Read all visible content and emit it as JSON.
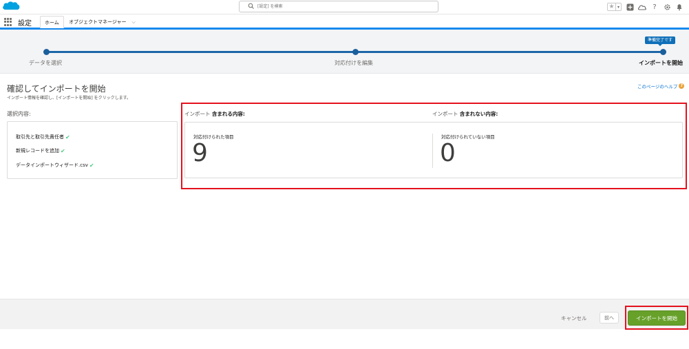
{
  "header": {
    "search_placeholder": "[設定] を検索",
    "icons": [
      "star-icon",
      "chevron-down-icon",
      "plus-icon",
      "cloud-icon",
      "help-icon",
      "gear-icon",
      "bell-icon"
    ]
  },
  "nav": {
    "app_name": "設定",
    "tabs": [
      {
        "label": "ホーム",
        "active": true
      },
      {
        "label": "オブジェクトマネージャー",
        "active": false
      }
    ]
  },
  "progress": {
    "steps": [
      {
        "label": "データを選択"
      },
      {
        "label": "対応付けを編集"
      },
      {
        "label": "インポートを開始"
      }
    ],
    "current_step": 3,
    "status_badge": "準備完了です"
  },
  "main": {
    "title": "確認してインポートを開始",
    "subtitle": "インポート情報を確認し、[インポートを開始] をクリックします。",
    "help_link": "このページのヘルプ"
  },
  "selection": {
    "label": "選択内容:",
    "items": [
      {
        "text": "取引先と取引先責任者"
      },
      {
        "text": "新規レコードを追加"
      },
      {
        "text": "データインポートウィザード.csv"
      }
    ]
  },
  "summary": {
    "included_prefix": "インポート",
    "included_bold": "含まれる内容:",
    "excluded_prefix": "インポート",
    "excluded_bold": "含まれない内容:",
    "mapped_label": "対応付けられた項目",
    "mapped_count": "9",
    "unmapped_label": "対応付けられていない項目",
    "unmapped_count": "0"
  },
  "footer": {
    "cancel_label": "キャンセル",
    "back_label": "前へ",
    "start_label": "インポートを開始"
  },
  "colors": {
    "accent": "#1589ee",
    "progress": "#1b66a8",
    "start_button": "#67a12a",
    "highlight": "#e4101c",
    "check": "#4bca81"
  }
}
